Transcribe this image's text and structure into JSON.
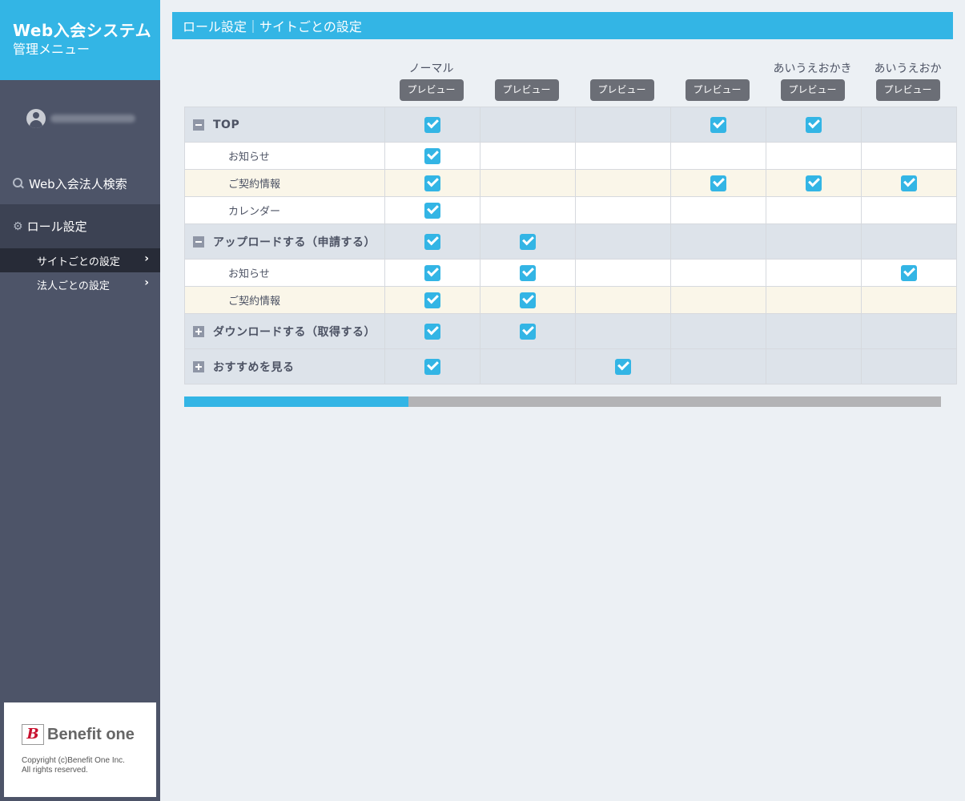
{
  "sidebar": {
    "app_title": "Web入会システム",
    "app_subtitle": "管理メニュー",
    "user_icon": "user-avatar-icon",
    "user_name": "",
    "nav": {
      "search": {
        "label": "Web入会法人検索",
        "icon": "search-icon"
      },
      "role": {
        "label": "ロール設定",
        "icon": "gears-icon"
      },
      "sub_items": [
        {
          "label": "サイトごとの設定",
          "active": true
        },
        {
          "label": "法人ごとの設定",
          "active": false
        }
      ]
    },
    "footer": {
      "logo_text": "Benefit one",
      "copyright_line1": "Copyright (c)Benefit One Inc.",
      "copyright_line2": "All rights reserved."
    }
  },
  "header": {
    "title": "ロール設定｜サイトごとの設定"
  },
  "columns": [
    {
      "name": "ノーマル",
      "blurred": false,
      "preview_label": "プレビュー"
    },
    {
      "name": "",
      "blurred": true,
      "preview_label": "プレビュー"
    },
    {
      "name": "",
      "blurred": true,
      "preview_label": "プレビュー"
    },
    {
      "name": "",
      "blurred": true,
      "preview_label": "プレビュー"
    },
    {
      "name": "あいうえおかき",
      "blurred": false,
      "preview_label": "プレビュー"
    },
    {
      "name": "あいうえおか",
      "blurred": false,
      "preview_label": "プレビュー"
    }
  ],
  "rows": [
    {
      "type": "group",
      "expanded": true,
      "label": "TOP",
      "checks": [
        true,
        false,
        false,
        true,
        true,
        false
      ]
    },
    {
      "type": "sub",
      "label": "お知らせ",
      "checks": [
        true,
        false,
        false,
        false,
        false,
        false
      ]
    },
    {
      "type": "sub",
      "alt": true,
      "label": "ご契約情報",
      "checks": [
        true,
        false,
        false,
        true,
        true,
        true
      ]
    },
    {
      "type": "sub",
      "label": "カレンダー",
      "checks": [
        true,
        false,
        false,
        false,
        false,
        false
      ]
    },
    {
      "type": "group",
      "expanded": true,
      "label": "アップロードする（申請する）",
      "checks": [
        true,
        true,
        false,
        false,
        false,
        false
      ]
    },
    {
      "type": "sub",
      "label": "お知らせ",
      "checks": [
        true,
        true,
        false,
        false,
        false,
        true
      ]
    },
    {
      "type": "sub",
      "alt": true,
      "label": "ご契約情報",
      "checks": [
        true,
        true,
        false,
        false,
        false,
        false
      ]
    },
    {
      "type": "group",
      "expanded": false,
      "label": "ダウンロードする（取得する）",
      "checks": [
        true,
        true,
        false,
        false,
        false,
        false
      ]
    },
    {
      "type": "group",
      "expanded": false,
      "label": "おすすめを見る",
      "checks": [
        true,
        false,
        true,
        false,
        false,
        false
      ]
    }
  ],
  "colors": {
    "accent": "#33b5e5",
    "sidebar": "#4d5468",
    "background": "#ecf0f4"
  }
}
